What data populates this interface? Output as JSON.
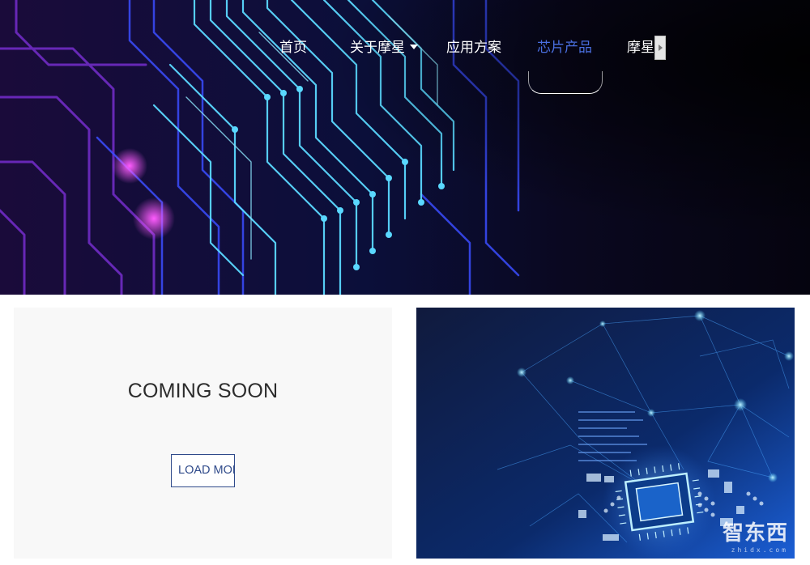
{
  "nav": {
    "items": [
      {
        "label": "首页"
      },
      {
        "label": "关于摩星",
        "has_dropdown": true
      },
      {
        "label": "应用方案"
      },
      {
        "label": "芯片产品",
        "active": true
      },
      {
        "label": "摩星"
      }
    ],
    "active_color": "#4a6fe0"
  },
  "hero": {
    "image": "circuit-board-banner",
    "colors": {
      "base": "#07061a",
      "cyan": "#5ad8ff",
      "blue": "#3a4bff",
      "purple": "#b03cff"
    }
  },
  "card_left": {
    "title": "COMING SOON",
    "button_label": "LOAD MORE",
    "accent": "#2f4a8a"
  },
  "card_right": {
    "image": "glowing-chip-network",
    "watermark": "智东西",
    "watermark_sub": "zhidx.com"
  }
}
